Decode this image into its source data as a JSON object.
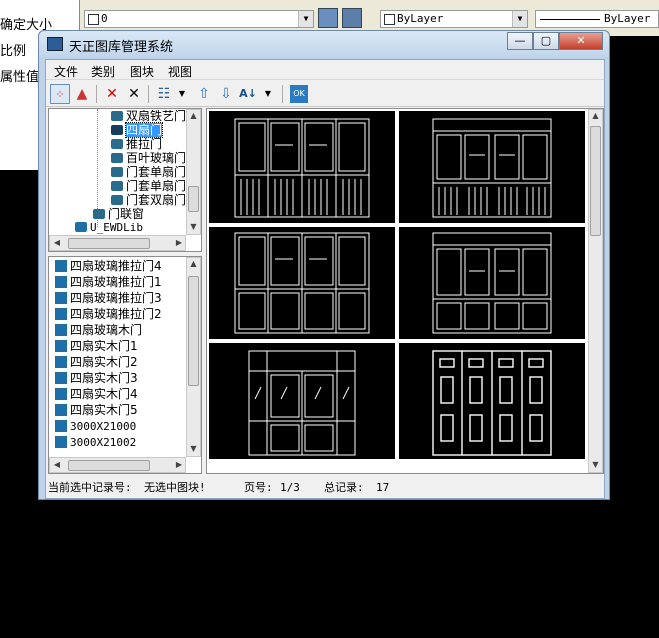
{
  "background": {
    "left_panel_items": [
      "确定大小",
      "比例",
      "属性值"
    ],
    "layer_combo_value": "0",
    "color_combo_value": "ByLayer",
    "linetype_combo_value": "ByLayer"
  },
  "window": {
    "title": "天正图库管理系统",
    "buttons": {
      "minimize": "—",
      "maximize": "▢",
      "close": "✕"
    }
  },
  "menubar": [
    "文件",
    "类别",
    "图块",
    "视图"
  ],
  "toolbar": {
    "icons": [
      "select-all-icon",
      "add-icon",
      "delete-icon",
      "close-icon",
      "view-mode-icon",
      "arrow-up-icon",
      "arrow-down-icon",
      "sort-icon",
      "ok-icon"
    ],
    "ok_label": "OK"
  },
  "tree": {
    "nodes": [
      "双扇铁艺门",
      "四扇门",
      "推拉门",
      "百叶玻璃门",
      "门套单扇门",
      "门套单扇门",
      "门套双扇门",
      "门联窗",
      "U_EWDLib"
    ],
    "selected": "四扇门"
  },
  "list": {
    "items": [
      "四扇玻璃推拉门4",
      "四扇玻璃推拉门1",
      "四扇玻璃推拉门3",
      "四扇玻璃推拉门2",
      "四扇玻璃木门",
      "四扇实木门1",
      "四扇实木门2",
      "四扇实木门3",
      "四扇实木门4",
      "四扇实木门5",
      "3000X21000",
      "3000X21002"
    ]
  },
  "status": {
    "record_label": "当前选中记录号:",
    "record_value": "无选中图块!",
    "page_label": "页号:",
    "page_value": "1/3",
    "total_label": "总记录:",
    "total_value": "17"
  }
}
